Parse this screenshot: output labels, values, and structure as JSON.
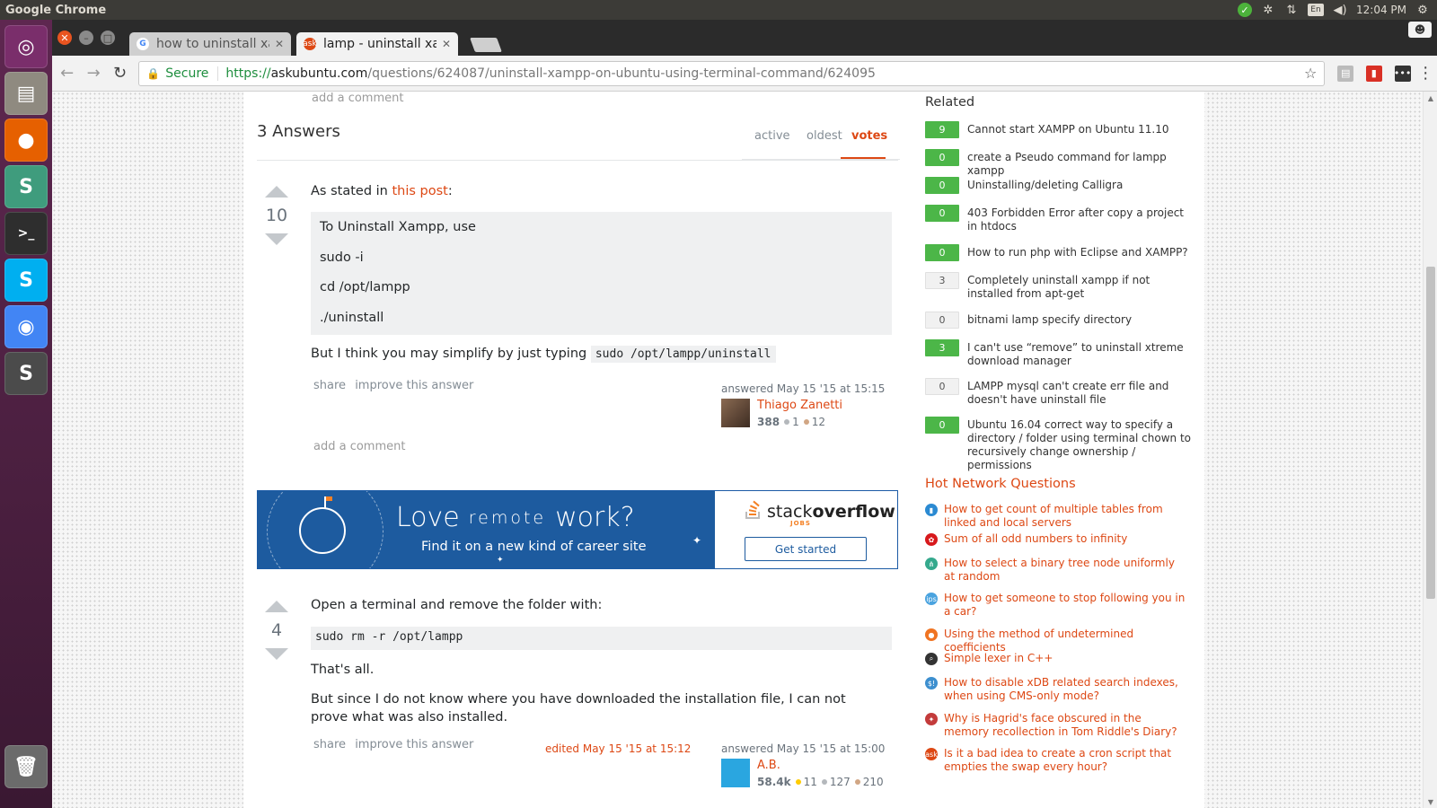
{
  "os": {
    "app_title": "Google Chrome",
    "clock": "12:04 PM",
    "keyboard_layout": "En",
    "launcher": [
      {
        "name": "ubuntu-dash",
        "color": "#7a2e6b",
        "glyph": "◎"
      },
      {
        "name": "files",
        "color": "#8f8a80",
        "glyph": "▤"
      },
      {
        "name": "firefox",
        "color": "#e66000",
        "glyph": "●"
      },
      {
        "name": "slack",
        "color": "#3f9c7d",
        "glyph": "S"
      },
      {
        "name": "terminal",
        "color": "#2e2e2e",
        "glyph": ">_"
      },
      {
        "name": "skype",
        "color": "#00aff0",
        "glyph": "S"
      },
      {
        "name": "chrome",
        "color": "#4285f4",
        "glyph": "◉"
      },
      {
        "name": "sublime",
        "color": "#4b4b4b",
        "glyph": "S"
      },
      {
        "name": "trash",
        "color": "#6b6b6b",
        "glyph": "🗑"
      }
    ]
  },
  "browser": {
    "tabs": [
      {
        "label": "how to uninstall xampp",
        "favicon": "G",
        "favicon_color": "#4285f4",
        "active": false
      },
      {
        "label": "lamp - uninstall xampp",
        "favicon": "ask",
        "favicon_color": "#dd4814",
        "active": true
      }
    ],
    "address": {
      "secure_label": "Secure",
      "scheme": "https://",
      "host": "askubuntu.com",
      "path": "/questions/624087/uninstall-xampp-on-ubuntu-using-terminal-command/624095"
    }
  },
  "page": {
    "prev_add_comment": "add a comment",
    "answers_title": "3 Answers",
    "sort_tabs": [
      {
        "label": "active",
        "active": false
      },
      {
        "label": "oldest",
        "active": false
      },
      {
        "label": "votes",
        "active": true
      }
    ],
    "answers": [
      {
        "votes": "10",
        "intro_prefix": "As stated in ",
        "intro_link": "this post",
        "intro_suffix": ":",
        "quote_lines": [
          "To Uninstall Xampp, use",
          "sudo -i",
          "cd /opt/lampp",
          "./uninstall"
        ],
        "after_text": "But I think you may simplify by just typing ",
        "after_code": "sudo /opt/lampp/uninstall",
        "menu": [
          "share",
          "improve this answer"
        ],
        "answered": "answered May 15 '15 at 15:15",
        "user": {
          "name": "Thiago Zanetti",
          "rep": "388",
          "silver": "1",
          "bronze": "12"
        },
        "add_comment": "add a comment"
      },
      {
        "votes": "4",
        "text1": "Open a terminal and remove the folder with:",
        "code": "sudo rm -r /opt/lampp",
        "text2": "That's all.",
        "text3": "But since I do not know where you have downloaded the installation file, I can not prove what was also installed.",
        "menu": [
          "share",
          "improve this answer"
        ],
        "edited": "edited May 15 '15 at 15:12",
        "answered": "answered May 15 '15 at 15:00",
        "user": {
          "name": "A.B.",
          "rep": "58.4k",
          "gold": "11",
          "silver": "127",
          "bronze": "210"
        }
      }
    ],
    "ad": {
      "love": "Love",
      "remote": "remote",
      "work": "work?",
      "tagline": "Find it on a new kind of career site",
      "brand_stack": "stack",
      "brand_overflow": "overflow",
      "brand_jobs": "JOBS",
      "cta": "Get started"
    }
  },
  "sidebar": {
    "related_title": "Related",
    "related": [
      {
        "score": "9",
        "accepted": true,
        "title": "Cannot start XAMPP on Ubuntu 11.10"
      },
      {
        "score": "0",
        "accepted": true,
        "title": "create a Pseudo command for lampp xampp"
      },
      {
        "score": "0",
        "accepted": true,
        "title": "Uninstalling/deleting Calligra"
      },
      {
        "score": "0",
        "accepted": true,
        "title": "403 Forbidden Error after copy a project in htdocs"
      },
      {
        "score": "0",
        "accepted": true,
        "title": "How to run php with Eclipse and XAMPP?"
      },
      {
        "score": "3",
        "accepted": false,
        "title": "Completely uninstall xampp if not installed from apt-get"
      },
      {
        "score": "0",
        "accepted": false,
        "title": "bitnami lamp specify directory"
      },
      {
        "score": "3",
        "accepted": true,
        "title": "I can't use “remove” to uninstall xtreme download manager"
      },
      {
        "score": "0",
        "accepted": false,
        "title": "LAMPP mysql can't create err file and doesn't have uninstall file"
      },
      {
        "score": "0",
        "accepted": true,
        "title": "Ubuntu 16.04 correct way to specify a directory / folder using terminal chown to recursively change ownership / permissions"
      }
    ],
    "hnq_title": "Hot Network Questions",
    "hnq": [
      {
        "icon": "dba-icon",
        "color": "#2b8ad2",
        "title": "How to get count of multiple tables from linked and local servers"
      },
      {
        "icon": "math-icon",
        "color": "#d7191c",
        "title": "Sum of all odd numbers to infinity"
      },
      {
        "icon": "cs-icon",
        "color": "#35a98d",
        "title": "How to select a binary tree node uniformly at random"
      },
      {
        "icon": "ips-icon",
        "color": "#4aa3df",
        "title": "How to get someone to stop following you in a car?"
      },
      {
        "icon": "mathematica-icon",
        "color": "#f07422",
        "title": "Using the method of undetermined coefficients"
      },
      {
        "icon": "codereview-icon",
        "color": "#333333",
        "title": "Simple lexer in C++"
      },
      {
        "icon": "sharepoint-icon",
        "color": "#3d8fcf",
        "title": "How to disable xDB related search indexes, when using CMS-only mode?"
      },
      {
        "icon": "scifi-icon",
        "color": "#c33b3b",
        "title": "Why is Hagrid's face obscured in the memory recollection in Tom Riddle's Diary?"
      },
      {
        "icon": "askubuntu-icon",
        "color": "#dd4814",
        "title": "Is it a bad idea to create a cron script that empties the swap every hour?"
      }
    ]
  }
}
